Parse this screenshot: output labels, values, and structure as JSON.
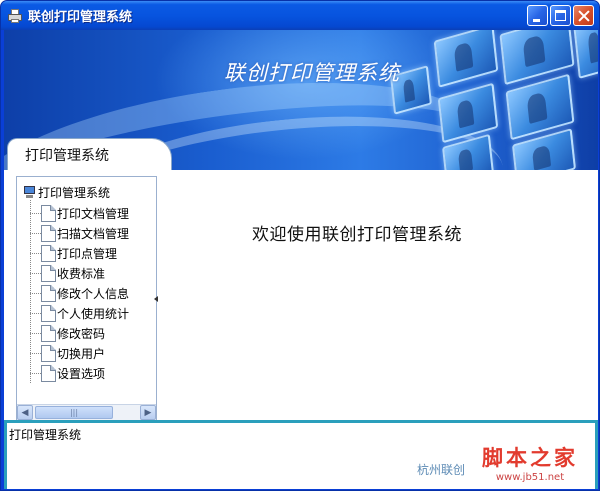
{
  "window": {
    "title": "联创打印管理系统"
  },
  "banner": {
    "title": "联创打印管理系统"
  },
  "tab": {
    "label": "打印管理系统"
  },
  "tree": {
    "root": "打印管理系统",
    "items": [
      "打印文档管理",
      "扫描文档管理",
      "打印点管理",
      "收费标准",
      "修改个人信息",
      "个人使用统计",
      "修改密码",
      "切换用户",
      "设置选项"
    ]
  },
  "main": {
    "welcome": "欢迎使用联创打印管理系统"
  },
  "status": {
    "text": "打印管理系统",
    "footer": "杭州联创"
  },
  "watermark": {
    "main": "脚本之家",
    "url": "www.jb51.net"
  },
  "icons": {
    "app": "printer-icon",
    "root": "computer-icon",
    "item": "document-icon"
  },
  "colors": {
    "titlebar": "#0754df",
    "status_border": "#2a9fbc",
    "watermark": "#e23b2e"
  }
}
